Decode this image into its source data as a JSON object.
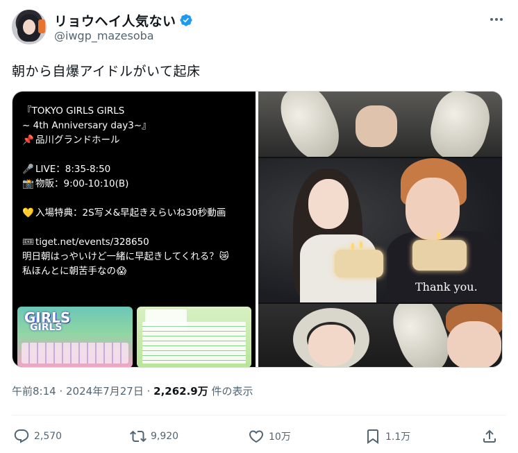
{
  "author": {
    "display_name": "リョウヘイ人気ない",
    "handle": "@iwgp_mazesoba",
    "verified": true
  },
  "tweet": {
    "text": "朝から自爆アイドルがいて起床"
  },
  "media": {
    "left_panel": {
      "title_line1": "『TOKYO GIRLS GIRLS",
      "title_line2": "~ 4th Anniversary day3~』",
      "venue": "品川グランドホール",
      "live": "LIVE：8:35-8:50",
      "merch": "物販：9:00-10:10(B)",
      "bonus": "入場特典：2S写メ&早起きえらいね30秒動画",
      "link": "tiget.net/events/328650",
      "message1": "明日朝はっやいけど一緒に早起きしてくれる？",
      "message2": "私ほんとに朝苦手なの",
      "poster_brand": "GIRLS",
      "poster_brand2": "GIRLS"
    },
    "right_panel": {
      "caption": "Thank you."
    }
  },
  "meta": {
    "time": "午前8:14",
    "date": "2024年7月27日",
    "views_count": "2,262.9万",
    "views_label": "件の表示"
  },
  "actions": {
    "reply_count": "2,570",
    "retweet_count": "9,920",
    "like_count": "10万",
    "bookmark_count": "1.1万"
  },
  "colors": {
    "verified_blue": "#1d9bf0",
    "text_primary": "#0f1419",
    "text_secondary": "#536471"
  }
}
